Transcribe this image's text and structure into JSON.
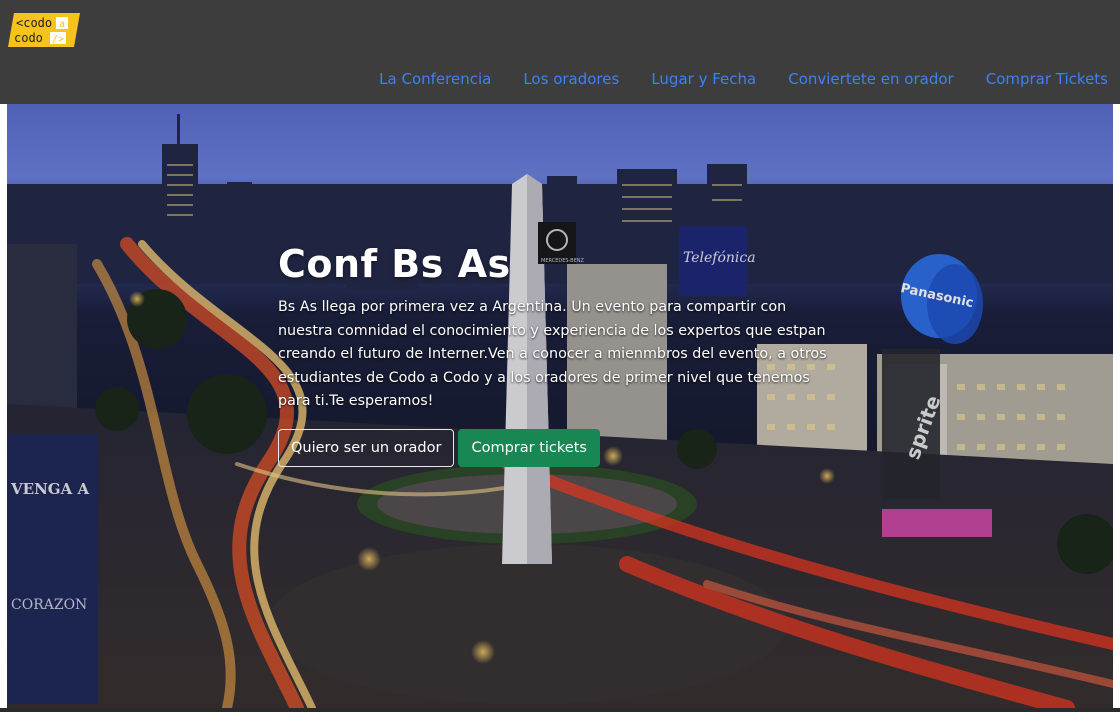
{
  "logo": {
    "line1": "<codo",
    "line1_suffix": "a",
    "line2": "codo",
    "line2_suffix": "/>"
  },
  "nav": {
    "items": [
      {
        "label": "La Conferencia"
      },
      {
        "label": "Los oradores"
      },
      {
        "label": "Lugar y Fecha"
      },
      {
        "label": "Conviertete en orador"
      },
      {
        "label": "Comprar Tickets"
      }
    ]
  },
  "hero": {
    "title": "Conf Bs As",
    "text": "Bs As llega por primera vez a Argentina. Un evento para compartir con nuestra comnidad el conocimiento y experiencia de los expertos que estpan creando el futuro de Interner.Ven a conocer a mienmbros del evento, a otros estudiantes de Codo a Codo y a los oradores de primer nivel que tenemos para ti.Te esperamos!",
    "btn_speaker": "Quiero ser un orador",
    "btn_tickets": "Comprar tickets",
    "sign_mercedes": "MERCEDES-BENZ",
    "sign_telefonica": "Telefónica",
    "sign_panasonic": "Panasonic",
    "sign_sprite": "sprite",
    "sign_corazon": "CORAZON",
    "sign_venga": "VENGA A"
  },
  "colors": {
    "nav_bg": "#3d3d3d",
    "link": "#3b82f6",
    "accent_green": "#198754",
    "logo_yellow": "#f6c21c"
  }
}
